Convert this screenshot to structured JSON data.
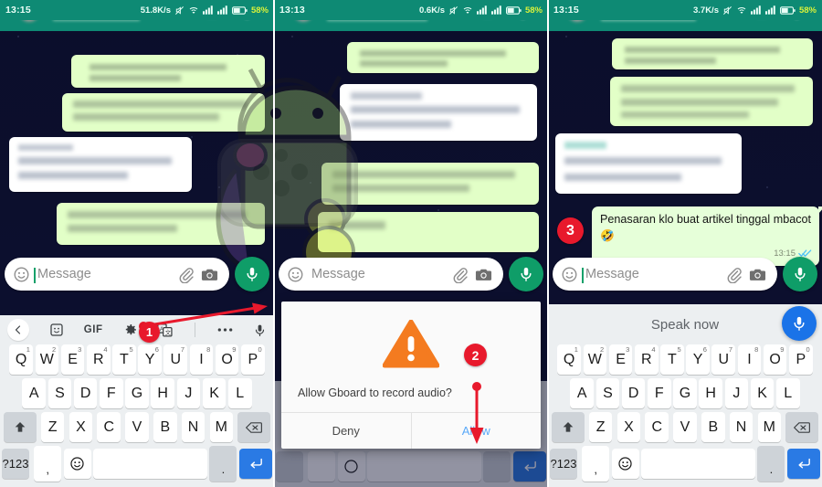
{
  "panels": [
    {
      "id": "panel-1",
      "status": {
        "time": "13:15",
        "net_speed": "51.8K/s",
        "battery": "58%",
        "icons": [
          "mute-icon",
          "wifi-icon",
          "signal-1-icon",
          "signal-2-icon",
          "battery-icon"
        ]
      },
      "input": {
        "placeholder": "Message",
        "emoji_icon": "emoji-icon",
        "attach_icon": "paperclip-icon",
        "camera_icon": "camera-icon",
        "mic_icon": "mic-icon",
        "mic_color": "#0f9d68"
      },
      "keyboard": {
        "toolbar": [
          "back-chevron-icon",
          "sticker-icon",
          "gif-icon",
          "gear-icon",
          "translate-icon",
          "overflow-icon",
          "mic-icon"
        ],
        "gif_label": "GIF",
        "row1": [
          {
            "k": "Q",
            "n": "1"
          },
          {
            "k": "W",
            "n": "2"
          },
          {
            "k": "E",
            "n": "3"
          },
          {
            "k": "R",
            "n": "4"
          },
          {
            "k": "T",
            "n": "5"
          },
          {
            "k": "Y",
            "n": "6"
          },
          {
            "k": "U",
            "n": "7"
          },
          {
            "k": "I",
            "n": "8"
          },
          {
            "k": "O",
            "n": "9"
          },
          {
            "k": "P",
            "n": "0"
          }
        ],
        "row2": [
          "A",
          "S",
          "D",
          "F",
          "G",
          "H",
          "J",
          "K",
          "L"
        ],
        "row3": [
          "Z",
          "X",
          "C",
          "V",
          "B",
          "N",
          "M"
        ],
        "shift_icon": "shift-icon",
        "backspace_icon": "backspace-icon",
        "symbols_label": "?123",
        "comma_label": ",",
        "emoji_key_icon": "emoji-key-icon",
        "space_label": "",
        "period_label": ".",
        "enter_icon": "enter-icon"
      },
      "annotation": {
        "badge": "1",
        "arrow": "arrow-to-mic"
      }
    },
    {
      "id": "panel-2",
      "status": {
        "time": "13:13",
        "net_speed": "0.6K/s",
        "battery": "58%",
        "icons": [
          "mute-icon",
          "wifi-icon",
          "signal-1-icon",
          "signal-2-icon",
          "battery-icon"
        ]
      },
      "input": {
        "placeholder": "Message",
        "emoji_icon": "emoji-icon",
        "attach_icon": "paperclip-icon",
        "camera_icon": "camera-icon",
        "mic_icon": "mic-icon",
        "mic_color": "#0f9d68"
      },
      "dialog": {
        "warning_icon": "warning-triangle-icon",
        "message": "Allow Gboard to record audio?",
        "deny_label": "Deny",
        "allow_label": "Allow",
        "accent": "#5aa9f8"
      },
      "annotation": {
        "badge": "2",
        "arrow": "arrow-down-to-allow"
      }
    },
    {
      "id": "panel-3",
      "status": {
        "time": "13:15",
        "net_speed": "3.7K/s",
        "battery": "58%",
        "icons": [
          "mute-icon",
          "wifi-icon",
          "signal-1-icon",
          "signal-2-icon",
          "battery-icon"
        ]
      },
      "message": {
        "text": "Penasaran klo buat artikel tinggal mbacot 🤣",
        "time": "13:15",
        "ticks_icon": "double-check-icon",
        "ticks_color": "#4fc3f7"
      },
      "input": {
        "placeholder": "Message",
        "emoji_icon": "emoji-icon",
        "attach_icon": "paperclip-icon",
        "camera_icon": "camera-icon",
        "mic_icon": "mic-icon",
        "mic_color": "#0f9d68"
      },
      "voice": {
        "prompt": "Speak now",
        "mic_icon": "mic-icon",
        "mic_color": "#1a73e8"
      },
      "keyboard": {
        "row1": [
          {
            "k": "Q",
            "n": "1"
          },
          {
            "k": "W",
            "n": "2"
          },
          {
            "k": "E",
            "n": "3"
          },
          {
            "k": "R",
            "n": "4"
          },
          {
            "k": "T",
            "n": "5"
          },
          {
            "k": "Y",
            "n": "6"
          },
          {
            "k": "U",
            "n": "7"
          },
          {
            "k": "I",
            "n": "8"
          },
          {
            "k": "O",
            "n": "9"
          },
          {
            "k": "P",
            "n": "0"
          }
        ],
        "row2": [
          "A",
          "S",
          "D",
          "F",
          "G",
          "H",
          "J",
          "K",
          "L"
        ],
        "row3": [
          "Z",
          "X",
          "C",
          "V",
          "B",
          "N",
          "M"
        ],
        "shift_icon": "shift-icon",
        "backspace_icon": "backspace-icon",
        "symbols_label": "?123",
        "comma_label": ",",
        "emoji_key_icon": "emoji-key-icon",
        "period_label": ".",
        "enter_icon": "enter-icon"
      },
      "annotation": {
        "badge": "3"
      }
    }
  ],
  "colors": {
    "whatsapp_green": "#0e8a74",
    "mic_green": "#0f9d68",
    "enter_blue": "#2a7ae4",
    "voice_blue": "#1a73e8",
    "badge_red": "#e8192c",
    "warning_orange": "#f47b20",
    "bubble_out": "#e6ffd9"
  }
}
